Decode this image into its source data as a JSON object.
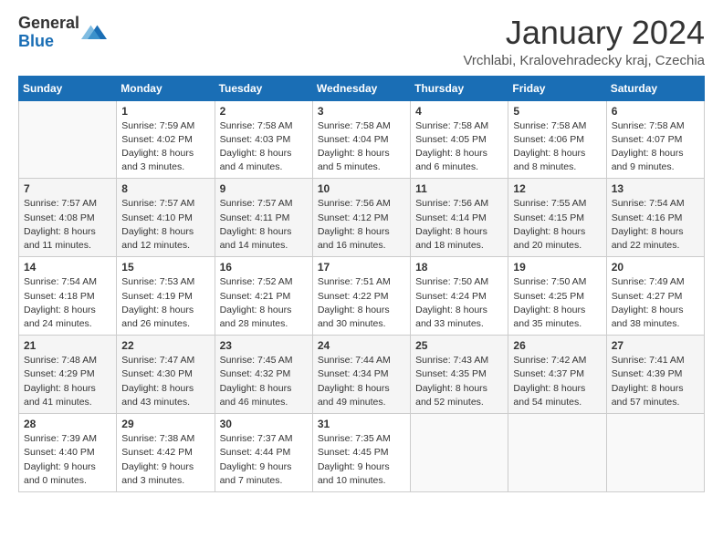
{
  "header": {
    "logo_general": "General",
    "logo_blue": "Blue",
    "title": "January 2024",
    "subtitle": "Vrchlabi, Kralovehradecky kraj, Czechia"
  },
  "days_of_week": [
    "Sunday",
    "Monday",
    "Tuesday",
    "Wednesday",
    "Thursday",
    "Friday",
    "Saturday"
  ],
  "weeks": [
    [
      {
        "num": "",
        "info": ""
      },
      {
        "num": "1",
        "info": "Sunrise: 7:59 AM\nSunset: 4:02 PM\nDaylight: 8 hours\nand 3 minutes."
      },
      {
        "num": "2",
        "info": "Sunrise: 7:58 AM\nSunset: 4:03 PM\nDaylight: 8 hours\nand 4 minutes."
      },
      {
        "num": "3",
        "info": "Sunrise: 7:58 AM\nSunset: 4:04 PM\nDaylight: 8 hours\nand 5 minutes."
      },
      {
        "num": "4",
        "info": "Sunrise: 7:58 AM\nSunset: 4:05 PM\nDaylight: 8 hours\nand 6 minutes."
      },
      {
        "num": "5",
        "info": "Sunrise: 7:58 AM\nSunset: 4:06 PM\nDaylight: 8 hours\nand 8 minutes."
      },
      {
        "num": "6",
        "info": "Sunrise: 7:58 AM\nSunset: 4:07 PM\nDaylight: 8 hours\nand 9 minutes."
      }
    ],
    [
      {
        "num": "7",
        "info": "Sunrise: 7:57 AM\nSunset: 4:08 PM\nDaylight: 8 hours\nand 11 minutes."
      },
      {
        "num": "8",
        "info": "Sunrise: 7:57 AM\nSunset: 4:10 PM\nDaylight: 8 hours\nand 12 minutes."
      },
      {
        "num": "9",
        "info": "Sunrise: 7:57 AM\nSunset: 4:11 PM\nDaylight: 8 hours\nand 14 minutes."
      },
      {
        "num": "10",
        "info": "Sunrise: 7:56 AM\nSunset: 4:12 PM\nDaylight: 8 hours\nand 16 minutes."
      },
      {
        "num": "11",
        "info": "Sunrise: 7:56 AM\nSunset: 4:14 PM\nDaylight: 8 hours\nand 18 minutes."
      },
      {
        "num": "12",
        "info": "Sunrise: 7:55 AM\nSunset: 4:15 PM\nDaylight: 8 hours\nand 20 minutes."
      },
      {
        "num": "13",
        "info": "Sunrise: 7:54 AM\nSunset: 4:16 PM\nDaylight: 8 hours\nand 22 minutes."
      }
    ],
    [
      {
        "num": "14",
        "info": "Sunrise: 7:54 AM\nSunset: 4:18 PM\nDaylight: 8 hours\nand 24 minutes."
      },
      {
        "num": "15",
        "info": "Sunrise: 7:53 AM\nSunset: 4:19 PM\nDaylight: 8 hours\nand 26 minutes."
      },
      {
        "num": "16",
        "info": "Sunrise: 7:52 AM\nSunset: 4:21 PM\nDaylight: 8 hours\nand 28 minutes."
      },
      {
        "num": "17",
        "info": "Sunrise: 7:51 AM\nSunset: 4:22 PM\nDaylight: 8 hours\nand 30 minutes."
      },
      {
        "num": "18",
        "info": "Sunrise: 7:50 AM\nSunset: 4:24 PM\nDaylight: 8 hours\nand 33 minutes."
      },
      {
        "num": "19",
        "info": "Sunrise: 7:50 AM\nSunset: 4:25 PM\nDaylight: 8 hours\nand 35 minutes."
      },
      {
        "num": "20",
        "info": "Sunrise: 7:49 AM\nSunset: 4:27 PM\nDaylight: 8 hours\nand 38 minutes."
      }
    ],
    [
      {
        "num": "21",
        "info": "Sunrise: 7:48 AM\nSunset: 4:29 PM\nDaylight: 8 hours\nand 41 minutes."
      },
      {
        "num": "22",
        "info": "Sunrise: 7:47 AM\nSunset: 4:30 PM\nDaylight: 8 hours\nand 43 minutes."
      },
      {
        "num": "23",
        "info": "Sunrise: 7:45 AM\nSunset: 4:32 PM\nDaylight: 8 hours\nand 46 minutes."
      },
      {
        "num": "24",
        "info": "Sunrise: 7:44 AM\nSunset: 4:34 PM\nDaylight: 8 hours\nand 49 minutes."
      },
      {
        "num": "25",
        "info": "Sunrise: 7:43 AM\nSunset: 4:35 PM\nDaylight: 8 hours\nand 52 minutes."
      },
      {
        "num": "26",
        "info": "Sunrise: 7:42 AM\nSunset: 4:37 PM\nDaylight: 8 hours\nand 54 minutes."
      },
      {
        "num": "27",
        "info": "Sunrise: 7:41 AM\nSunset: 4:39 PM\nDaylight: 8 hours\nand 57 minutes."
      }
    ],
    [
      {
        "num": "28",
        "info": "Sunrise: 7:39 AM\nSunset: 4:40 PM\nDaylight: 9 hours\nand 0 minutes."
      },
      {
        "num": "29",
        "info": "Sunrise: 7:38 AM\nSunset: 4:42 PM\nDaylight: 9 hours\nand 3 minutes."
      },
      {
        "num": "30",
        "info": "Sunrise: 7:37 AM\nSunset: 4:44 PM\nDaylight: 9 hours\nand 7 minutes."
      },
      {
        "num": "31",
        "info": "Sunrise: 7:35 AM\nSunset: 4:45 PM\nDaylight: 9 hours\nand 10 minutes."
      },
      {
        "num": "",
        "info": ""
      },
      {
        "num": "",
        "info": ""
      },
      {
        "num": "",
        "info": ""
      }
    ]
  ]
}
